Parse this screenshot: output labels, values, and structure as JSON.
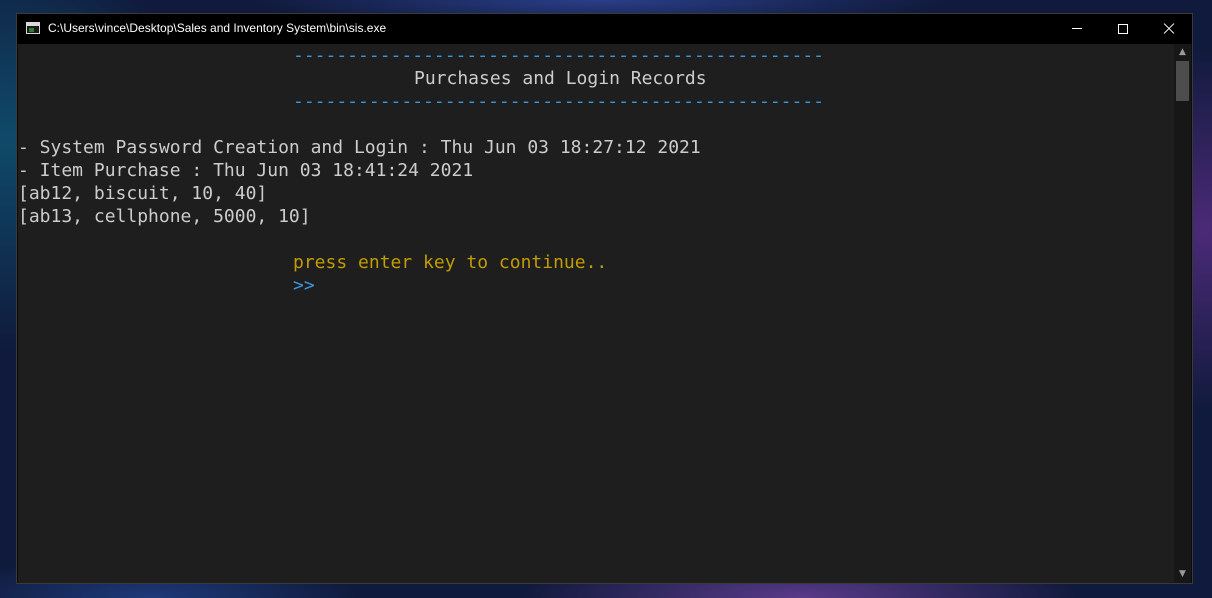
{
  "window": {
    "title": "C:\\Users\\vince\\Desktop\\Sales and Inventory System\\bin\\sis.exe",
    "icon": "console-app-icon"
  },
  "console": {
    "divider_top": "-------------------------------------------------",
    "heading": "Purchases and Login Records",
    "divider_bottom": "-------------------------------------------------",
    "records": [
      "- System Password Creation and Login : Thu Jun 03 18:27:12 2021",
      "- Item Purchase : Thu Jun 03 18:41:24 2021",
      "[ab12, biscuit, 10, 40]",
      "[ab13, cellphone, 5000, 10]"
    ],
    "prompt": "press enter key to continue..",
    "cursor": ">>"
  },
  "colors": {
    "console_background": "#1e1e1e",
    "text": "#cccccc",
    "divider": "#3a96dd",
    "prompt": "#c19c00",
    "cursor": "#3a96dd"
  }
}
